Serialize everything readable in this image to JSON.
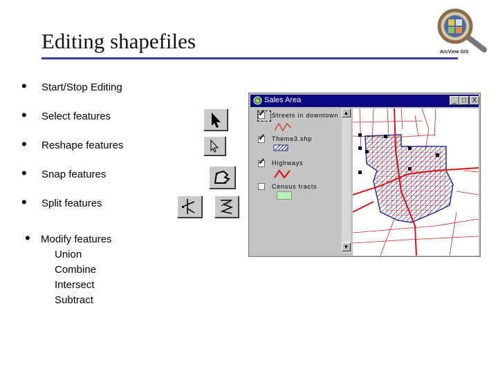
{
  "title": "Editing shapefiles",
  "bullets": [
    {
      "label": "Start/Stop Editing"
    },
    {
      "label": "Select features"
    },
    {
      "label": "Reshape features"
    },
    {
      "label": "Snap features"
    },
    {
      "label": "Split features"
    },
    {
      "label": "Modify features"
    }
  ],
  "bullet_glyph": "•",
  "modify_ops": [
    "Union",
    "Combine",
    "Intersect",
    "Subtract"
  ],
  "window": {
    "title": "Sales Area",
    "minimize": "_",
    "maximize": "□",
    "close": "X",
    "scroll_up": "▲",
    "scroll_down": "▼"
  },
  "layers": [
    {
      "name": "Streets in downtown",
      "checked": true,
      "check_glyph": "✓"
    },
    {
      "name": "Theme3.shp",
      "checked": true,
      "check_glyph": "✓"
    },
    {
      "name": "Highways",
      "checked": true,
      "check_glyph": "✓"
    },
    {
      "name": "Census tracts",
      "checked": false,
      "check_glyph": ""
    }
  ],
  "logo_text": "ArcView GIS",
  "colors": {
    "title_rule": "#3a3aa8",
    "window_title_bar": "#0a0a80",
    "streets": "#cc2222",
    "highway": "#dd1111",
    "theme_fill": "#2a2a8a",
    "census": "#b8f0b8"
  },
  "icons": [
    "select-arrow-icon",
    "vertex-edit-icon",
    "snap-icon",
    "split-line-icon",
    "split-polygon-icon",
    "magnifier-logo-icon"
  ]
}
